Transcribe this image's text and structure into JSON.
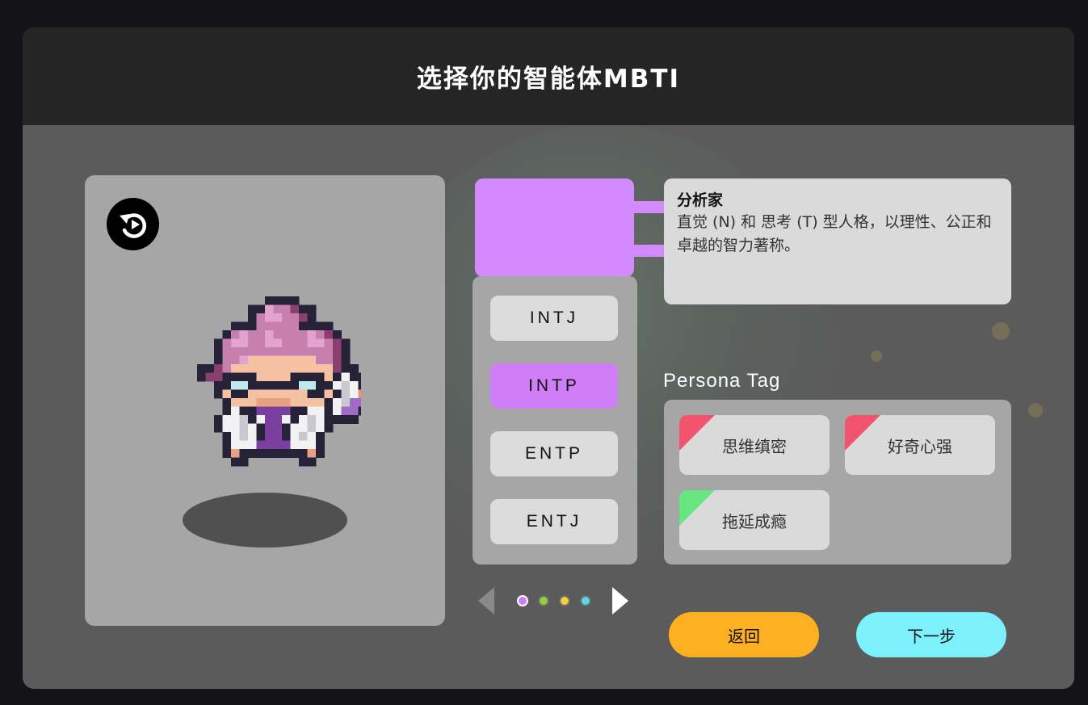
{
  "header": {
    "title": "选择你的智能体MBTI"
  },
  "colors": {
    "accent_purple": "#d48aff",
    "active_type": "#cf7ef7",
    "back_button": "#ffb020",
    "next_button": "#7cf0fb",
    "tag_negative": "#f2546e",
    "tag_positive": "#66e680"
  },
  "avatar": {
    "reset_icon": "reset-icon",
    "character": "pixel-character-sprite"
  },
  "mbti": {
    "types": [
      {
        "label": "INTJ",
        "active": false
      },
      {
        "label": "INTP",
        "active": true
      },
      {
        "label": "ENTP",
        "active": false
      },
      {
        "label": "ENTJ",
        "active": false
      }
    ]
  },
  "group": {
    "title": "分析家",
    "description": "直觉 (N) 和 思考 (T) 型人格，以理性、公正和卓越的智力著称。"
  },
  "persona": {
    "label": "Persona Tag",
    "tags": [
      {
        "label": "思维缜密",
        "corner_color": "#f2546e"
      },
      {
        "label": "好奇心强",
        "corner_color": "#f2546e"
      },
      {
        "label": "拖延成瘾",
        "corner_color": "#66e680"
      }
    ]
  },
  "pager": {
    "prev_icon": "chevron-left-icon",
    "next_icon": "chevron-right-icon",
    "dots": [
      {
        "color": "#cf7ef7",
        "active": true
      },
      {
        "color": "#8fcf3a",
        "active": false
      },
      {
        "color": "#f5cf3a",
        "active": false
      },
      {
        "color": "#5ad8e8",
        "active": false
      }
    ]
  },
  "actions": {
    "back_label": "返回",
    "next_label": "下一步"
  }
}
